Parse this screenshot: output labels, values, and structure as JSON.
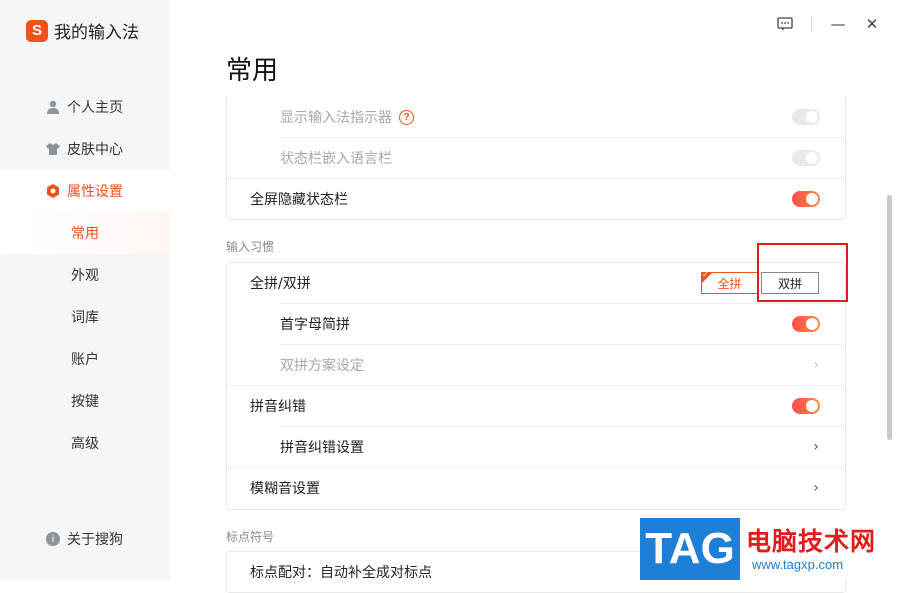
{
  "app": {
    "logo_letter": "S",
    "title": "我的输入法"
  },
  "window": {
    "feedback_icon": "feedback-icon",
    "minimize": "—",
    "close": "✕"
  },
  "sidebar": {
    "items": [
      {
        "label": "个人主页",
        "icon": "user-icon"
      },
      {
        "label": "皮肤中心",
        "icon": "shirt-icon"
      },
      {
        "label": "属性设置",
        "icon": "settings-hex-icon",
        "active": true
      }
    ],
    "sub_items": [
      {
        "label": "常用",
        "active": true
      },
      {
        "label": "外观"
      },
      {
        "label": "词库"
      },
      {
        "label": "账户"
      },
      {
        "label": "按键"
      },
      {
        "label": "高级"
      }
    ],
    "about": "关于搜狗"
  },
  "main": {
    "title": "常用",
    "status_card": {
      "rows": [
        {
          "label": "显示输入法指示器",
          "help": "?",
          "toggle": "off",
          "disabled": true
        },
        {
          "label": "状态栏嵌入语言栏",
          "toggle": "off",
          "disabled": true
        },
        {
          "label": "全屏隐藏状态栏",
          "toggle": "on"
        }
      ]
    },
    "habits": {
      "section_label": "输入习惯",
      "rows": [
        {
          "label": "全拼/双拼",
          "options": [
            "全拼",
            "双拼"
          ],
          "selected": "全拼"
        },
        {
          "label": "首字母简拼",
          "toggle": "on",
          "indent": true
        },
        {
          "label": "双拼方案设定",
          "chevron": true,
          "indent": true,
          "disabled": true
        },
        {
          "label": "拼音纠错",
          "toggle": "on"
        },
        {
          "label": "拼音纠错设置",
          "chevron": true,
          "indent": true
        },
        {
          "label": "模糊音设置",
          "chevron": true
        }
      ]
    },
    "punctuation": {
      "section_label": "标点符号",
      "rows": [
        {
          "label": "标点配对：自动补全成对标点"
        }
      ]
    }
  },
  "watermark": {
    "tag": "TAG",
    "site_cn": "电脑技术网",
    "url": "www.tagxp.com"
  },
  "colors": {
    "accent": "#f1511b",
    "highlight_box": "#e21b1b",
    "watermark_blue": "#1d7fd6"
  }
}
